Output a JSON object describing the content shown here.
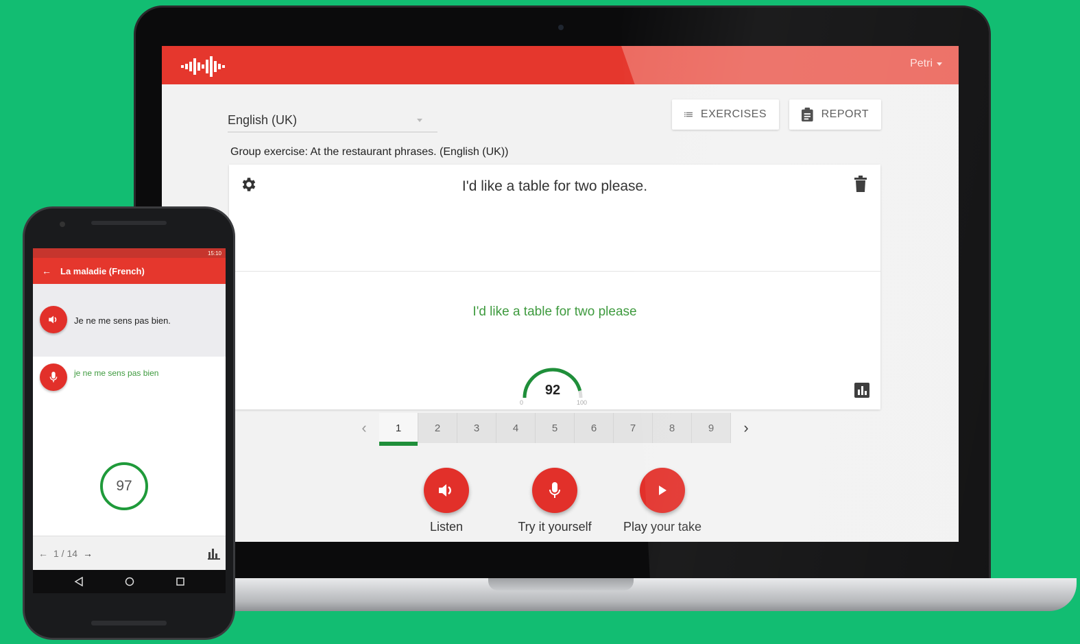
{
  "laptop": {
    "header": {
      "user": "Petri"
    },
    "language": "English (UK)",
    "buttons": {
      "exercises": "EXERCISES",
      "report": "REPORT"
    },
    "group_title": "Group exercise: At the restaurant phrases. (English (UK))",
    "card": {
      "phrase": "I'd like a table for two please.",
      "recognized": "I'd like a table for two please",
      "score": "92",
      "score_value": 92,
      "min": "0",
      "max": "100"
    },
    "pagination": {
      "pages": [
        "1",
        "2",
        "3",
        "4",
        "5",
        "6",
        "7",
        "8",
        "9"
      ],
      "active": "1"
    },
    "actions": {
      "listen": "Listen",
      "try": "Try it yourself",
      "play": "Play your take"
    }
  },
  "phone": {
    "status_time": "15:10",
    "title": "La maladie (French)",
    "phrase": "Je ne me sens pas bien.",
    "recognized": "je ne me sens pas bien",
    "score": "97",
    "counter": "1 / 14"
  },
  "colors": {
    "accent_red": "#e5372d",
    "green": "#1f8f3a",
    "background": "#12bd72"
  },
  "icons": {
    "logo": "sound-wave-logo",
    "exercises": "list-icon",
    "report": "clipboard-icon",
    "settings": "gear-icon",
    "delete": "trash-icon",
    "stats": "bar-chart-icon",
    "listen": "speaker-icon",
    "try": "microphone-icon",
    "play": "play-icon"
  }
}
